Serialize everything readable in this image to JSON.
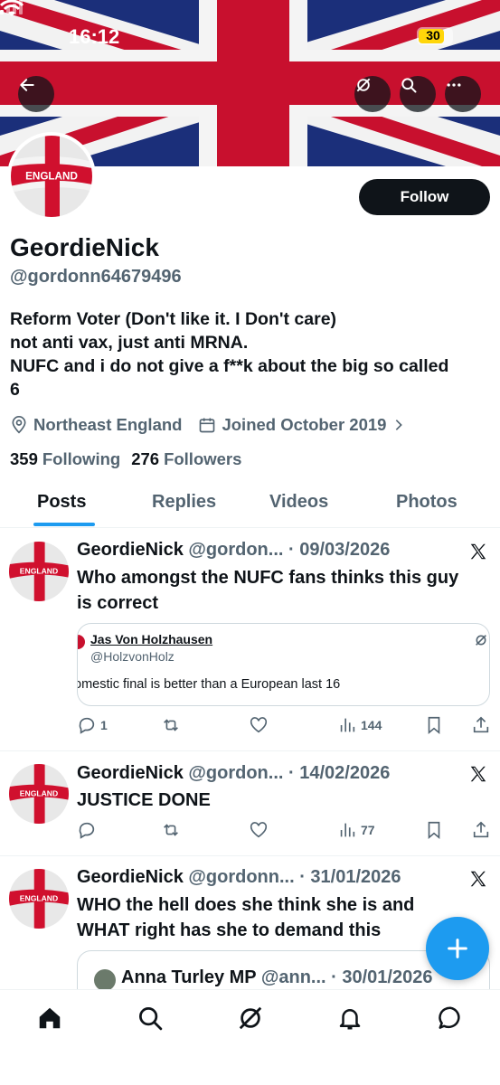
{
  "status_bar": {
    "time": "16:12",
    "battery": "30"
  },
  "profile": {
    "display_name": "GeordieNick",
    "handle": "@gordonn64679496",
    "follow_label": "Follow",
    "bio_lines": [
      "Reform Voter (Don't like it. I Don't care)",
      "not anti vax, just anti MRNA.",
      "NUFC and i do not give a f**k about the big so called",
      "6"
    ],
    "location": "Northeast England",
    "joined": "Joined October 2019",
    "following_count": "359",
    "following_label": "Following",
    "followers_count": "276",
    "followers_label": "Followers",
    "avatar_text": "ENGLAND"
  },
  "tabs": [
    "Posts",
    "Replies",
    "Videos",
    "Photos"
  ],
  "posts": [
    {
      "name": "GeordieNick",
      "handle": "@gordon...",
      "date": "· 09/03/2026",
      "text_lines": [
        "Who amongst the NUFC fans thinks this guy",
        "is correct"
      ],
      "quote": {
        "name": "Jas Von Holzhausen",
        "handle": "@HolzvonHolz",
        "text": "omestic final is better than a European last 16"
      },
      "replies": "1",
      "views": "144"
    },
    {
      "name": "GeordieNick",
      "handle": "@gordon...",
      "date": "· 14/02/2026",
      "text_lines": [
        "JUSTICE DONE"
      ],
      "replies": "",
      "views": "77"
    },
    {
      "name": "GeordieNick",
      "handle": "@gordonn...",
      "date": "· 31/01/2026",
      "text_lines": [
        "WHO the hell does she think she is and",
        "WHAT right has she to demand this"
      ],
      "quote": {
        "name": "Anna Turley MP",
        "handle": "@ann...",
        "date": "· 30/01/2026"
      }
    }
  ],
  "colors": {
    "accent": "#1d9bf0",
    "text": "#0f1419",
    "muted": "#536471"
  },
  "icons": {
    "back": "arrow-left-icon",
    "grok": "grok-icon",
    "search": "search-icon",
    "more": "more-icon",
    "location": "location-icon",
    "calendar": "calendar-icon",
    "x_logo": "x-logo-icon",
    "compose": "plus-icon"
  }
}
